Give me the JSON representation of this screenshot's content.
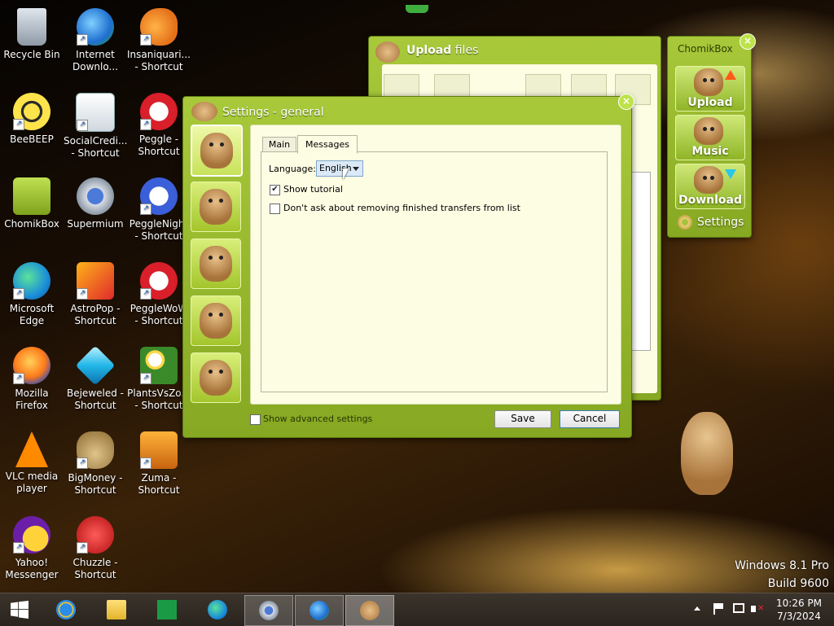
{
  "desktop": {
    "icons": [
      {
        "label": "Recycle Bin"
      },
      {
        "label": "Internet Downlo..."
      },
      {
        "label": "Insaniquari... - Shortcut"
      },
      {
        "label": "BeeBEEP"
      },
      {
        "label": "SocialCredi... - Shortcut"
      },
      {
        "label": "Peggle - Shortcut"
      },
      {
        "label": "ChomikBox"
      },
      {
        "label": "Supermium"
      },
      {
        "label": "PeggleNight - Shortcut"
      },
      {
        "label": "Microsoft Edge"
      },
      {
        "label": "AstroPop - Shortcut"
      },
      {
        "label": "PeggleWoW - Shortcut"
      },
      {
        "label": "Mozilla Firefox"
      },
      {
        "label": "Bejeweled - Shortcut"
      },
      {
        "label": "PlantsVsZo... - Shortcut"
      },
      {
        "label": "VLC media player"
      },
      {
        "label": "BigMoney - Shortcut"
      },
      {
        "label": "Zuma - Shortcut"
      },
      {
        "label": "Yahoo! Messenger"
      },
      {
        "label": "Chuzzle - Shortcut"
      }
    ],
    "watermark_line1": "Windows 8.1 Pro",
    "watermark_line2": "Build 9600"
  },
  "upload_window": {
    "title_bold": "Upload",
    "title_rest": " files"
  },
  "chomikbox_panel": {
    "title": "ChomikBox",
    "upload_label": "Upload",
    "music_label": "Music",
    "download_label": "Download",
    "settings_label": "Settings"
  },
  "settings_window": {
    "title": "Settings - general",
    "tabs": [
      {
        "label": "Main"
      },
      {
        "label": "Messages"
      }
    ],
    "language_label": "Language:",
    "language_value": "English",
    "show_tutorial_label": "Show tutorial",
    "show_tutorial_checked": true,
    "dont_ask_label": "Don't ask about removing finished transfers from list",
    "dont_ask_checked": false,
    "show_advanced_label": "Show advanced settings",
    "show_advanced_checked": false,
    "save_label": "Save",
    "cancel_label": "Cancel"
  },
  "taskbar": {
    "time": "10:26 PM",
    "date": "7/3/2024"
  },
  "colors": {
    "accent_green": "#9cbf2c",
    "panel_bg": "#fdfde4"
  }
}
